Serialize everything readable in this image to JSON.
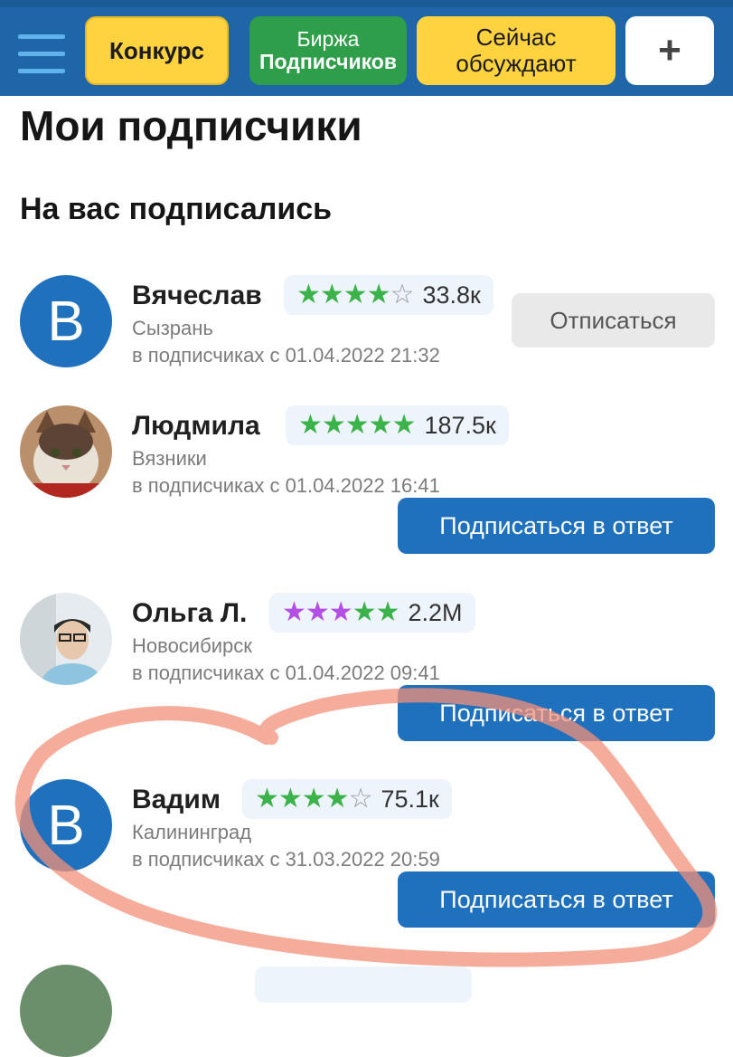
{
  "topbar": {
    "contest_label": "Конкурс",
    "exchange_line1": "Биржа",
    "exchange_line2": "Подписчиков",
    "discuss_line1": "Сейчас",
    "discuss_line2": "обсуждают",
    "plus_label": "+"
  },
  "page": {
    "title": "Мои подписчики",
    "section_title": "На вас подписались"
  },
  "subscribers": [
    {
      "initial": "В",
      "name": "Вячеслав",
      "stars_filled": "★★★★",
      "stars_empty": "☆",
      "rating": "33.8к",
      "city": "Сызрань",
      "since": "в подписчиках с 01.04.2022 21:32",
      "action": "Отписаться"
    },
    {
      "name": "Людмила",
      "stars_filled": "★★★★★",
      "rating": "187.5к",
      "city": "Вязники",
      "since": "в подписчиках с 01.04.2022 16:41",
      "action": "Подписаться в ответ"
    },
    {
      "name": "Ольга Л.",
      "stars_purple": "★★★",
      "stars_filled": "★★",
      "rating": "2.2М",
      "city": "Новосибирск",
      "since": "в подписчиках с 01.04.2022 09:41",
      "action": "Подписаться в ответ"
    },
    {
      "initial": "В",
      "name": "Вадим",
      "stars_filled": "★★★★",
      "stars_empty": "☆",
      "rating": "75.1к",
      "city": "Калининград",
      "since": "в подписчиках с 31.03.2022 20:59",
      "action": "Подписаться в ответ"
    }
  ],
  "colors": {
    "topbar": "#1f66a9",
    "accent_yellow": "#ffd23f",
    "accent_green": "#2e9e4a",
    "primary_button": "#1f70bd",
    "star_green": "#3cb24a",
    "star_purple": "#b44fe6",
    "highlight_ring": "#f19079"
  }
}
